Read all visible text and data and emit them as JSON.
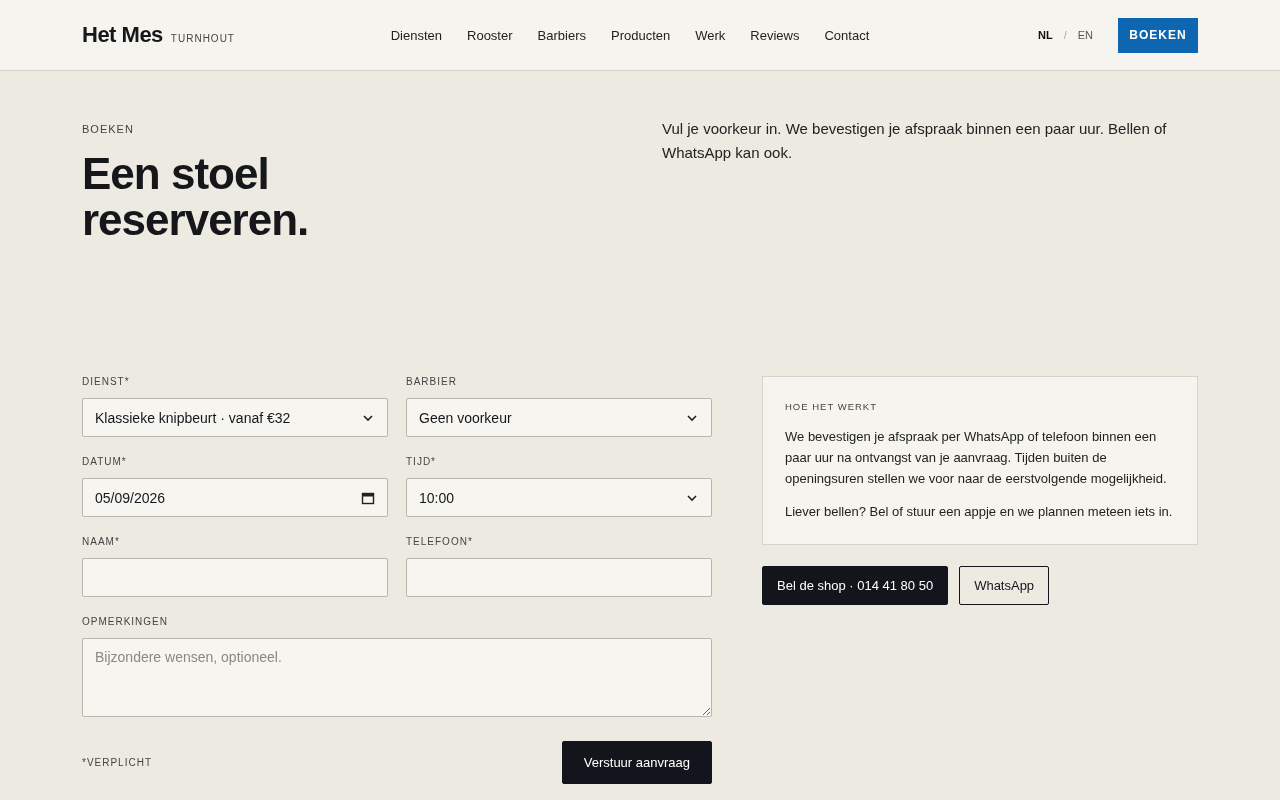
{
  "header": {
    "brand": "Het Mes",
    "city": "TURNHOUT",
    "nav": [
      "Diensten",
      "Rooster",
      "Barbiers",
      "Producten",
      "Werk",
      "Reviews",
      "Contact"
    ],
    "languages": [
      {
        "label": "NL",
        "selected": true
      },
      {
        "label": "EN",
        "selected": false
      }
    ],
    "separator": "/",
    "cta": "BOEKEN"
  },
  "hero": {
    "eyebrow": "BOEKEN",
    "title": "Een stoel reserveren.",
    "intro": "Vul je voorkeur in. We bevestigen je afspraak binnen een paar uur. Bellen of WhatsApp kan ook."
  },
  "form": {
    "fields": [
      {
        "label": "DIENST*",
        "kind": "select",
        "value": "Klassieke knipbeurt · vanaf €32"
      },
      {
        "label": "BARBIER",
        "kind": "select",
        "value": "Geen voorkeur"
      },
      {
        "label": "DATUM*",
        "kind": "date",
        "value": "05/09/2026"
      },
      {
        "label": "TIJD*",
        "kind": "select",
        "value": "10:00"
      },
      {
        "label": "NAAM*",
        "kind": "text"
      },
      {
        "label": "TELEFOON*",
        "kind": "text"
      },
      {
        "label": "OPMERKINGEN",
        "kind": "textarea",
        "placeholder": "Bijzondere wensen, optioneel."
      }
    ],
    "note": "*VERPLICHT",
    "submit": "Verstuur aanvraag"
  },
  "info": {
    "heading": "HOE HET WERKT",
    "paragraphs": [
      "We bevestigen je afspraak per WhatsApp of telefoon binnen een paar uur na ontvangst van je aanvraag. Tijden buiten de openingsuren stellen we voor naar de eerstvolgende mogelijkheid.",
      "Liever bellen? Bel of stuur een appje en we plannen meteen iets in."
    ],
    "buttons": [
      {
        "label": "Bel de shop · 014 41 80 50",
        "kind": "primary"
      },
      {
        "label": "WhatsApp",
        "kind": "outline"
      }
    ]
  }
}
